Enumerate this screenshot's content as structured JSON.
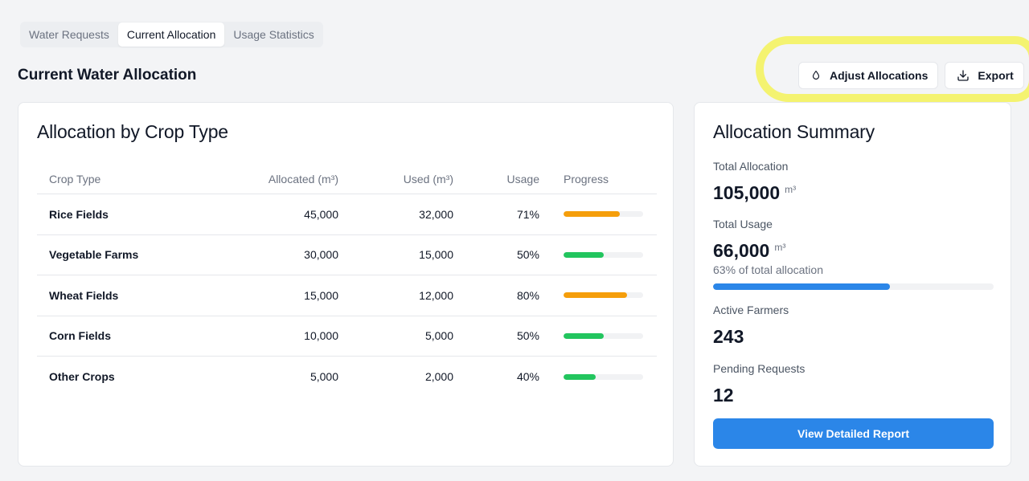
{
  "tabs": [
    {
      "label": "Water Requests",
      "active": false
    },
    {
      "label": "Current Allocation",
      "active": true
    },
    {
      "label": "Usage Statistics",
      "active": false
    }
  ],
  "page_title": "Current Water Allocation",
  "actions": {
    "adjust_label": "Adjust Allocations",
    "adjust_icon": "droplet-icon",
    "export_label": "Export",
    "export_icon": "download-icon"
  },
  "allocation_table": {
    "title": "Allocation by Crop Type",
    "headers": [
      "Crop Type",
      "Allocated (m³)",
      "Used (m³)",
      "Usage",
      "Progress"
    ],
    "rows": [
      {
        "crop": "Rice Fields",
        "allocated": "45,000",
        "used": "32,000",
        "usage": "71%",
        "progress": 0.71,
        "bar_color": "#f59e0b"
      },
      {
        "crop": "Vegetable Farms",
        "allocated": "30,000",
        "used": "15,000",
        "usage": "50%",
        "progress": 0.5,
        "bar_color": "#22c55e"
      },
      {
        "crop": "Wheat Fields",
        "allocated": "15,000",
        "used": "12,000",
        "usage": "80%",
        "progress": 0.8,
        "bar_color": "#f59e0b"
      },
      {
        "crop": "Corn Fields",
        "allocated": "10,000",
        "used": "5,000",
        "usage": "50%",
        "progress": 0.5,
        "bar_color": "#22c55e"
      },
      {
        "crop": "Other Crops",
        "allocated": "5,000",
        "used": "2,000",
        "usage": "40%",
        "progress": 0.4,
        "bar_color": "#22c55e"
      }
    ]
  },
  "summary": {
    "title": "Allocation Summary",
    "total_allocation_label": "Total Allocation",
    "total_allocation_value": "105,000",
    "unit": "m³",
    "total_usage_label": "Total Usage",
    "total_usage_value": "66,000",
    "usage_note": "63% of total allocation",
    "usage_fraction": 0.63,
    "active_farmers_label": "Active Farmers",
    "active_farmers_value": "243",
    "pending_requests_label": "Pending Requests",
    "pending_requests_value": "12",
    "report_button_label": "View Detailed Report"
  },
  "colors": {
    "accent": "#2b86e8",
    "warning": "#f59e0b",
    "success": "#22c55e",
    "highlight": "#f4f370"
  }
}
